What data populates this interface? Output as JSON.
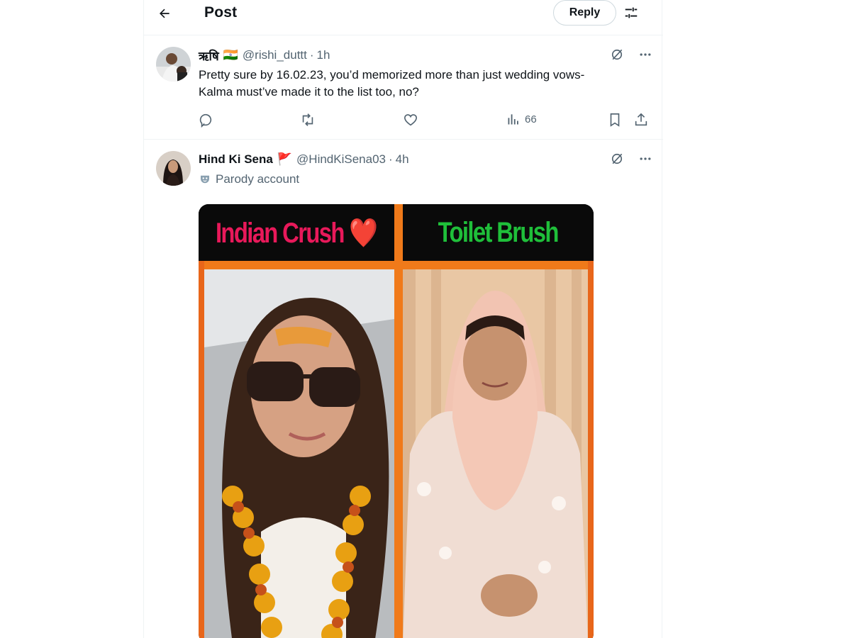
{
  "header": {
    "title": "Post",
    "reply_label": "Reply"
  },
  "tweets": [
    {
      "name": "ऋषि",
      "flag": "🇮🇳",
      "handle": "@rishi_duttt",
      "time": "1h",
      "text_line1": "Pretty sure by 16.02.23, you’d memorized more than just wedding vows-",
      "text_line2": "Kalma must’ve made it to the list too, no?",
      "views": "66"
    },
    {
      "name": "Hind Ki Sena",
      "flag": "🚩",
      "handle": "@HindKiSena03",
      "time": "4h",
      "parody_label": "Parody account",
      "media": {
        "left_label": "Indian Crush ❤️",
        "right_label": "Toilet Brush"
      }
    }
  ],
  "colors": {
    "left_label": "#e8195a",
    "right_label": "#1fbf3a",
    "frame": "#f07a1a"
  },
  "icons": [
    "back-arrow-icon",
    "filter-icon",
    "grok-icon",
    "more-icon",
    "reply-icon",
    "retweet-icon",
    "like-icon",
    "views-icon",
    "bookmark-icon",
    "share-icon",
    "parody-mask-icon"
  ]
}
